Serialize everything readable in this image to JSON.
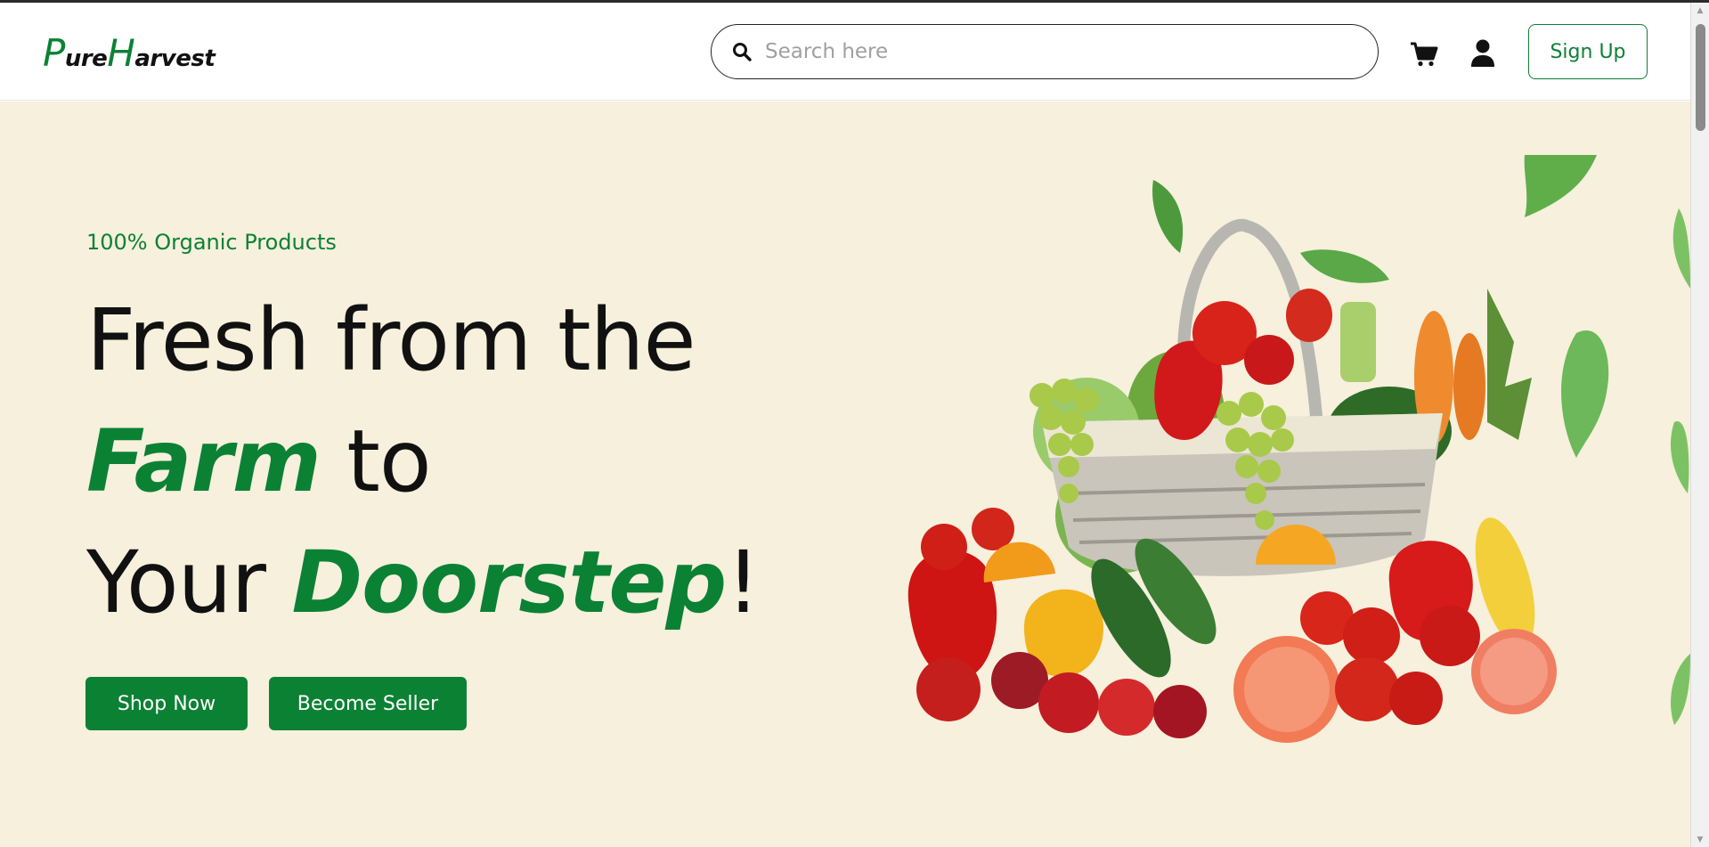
{
  "header": {
    "logo": {
      "first_cap": "P",
      "first_rest": "ure",
      "second_cap": "H",
      "second_rest": "arvest"
    },
    "search": {
      "placeholder": "Search here",
      "value": ""
    },
    "signup_label": "Sign Up"
  },
  "hero": {
    "tagline": "100% Organic Products",
    "headline": {
      "line1": "Fresh from the",
      "line2_accent": "Farm",
      "line2_rest": " to",
      "line3_start": "Your ",
      "line3_accent": "Doorstep",
      "line3_end": "!"
    },
    "buttons": {
      "shop": "Shop Now",
      "seller": "Become Seller"
    },
    "image_icon": "vegetable-basket-illustration"
  },
  "colors": {
    "brand_green": "#0b8134",
    "hero_background": "#f6f0dc",
    "text_dark": "#111111"
  },
  "icons": [
    "search-icon",
    "cart-icon",
    "user-icon"
  ]
}
